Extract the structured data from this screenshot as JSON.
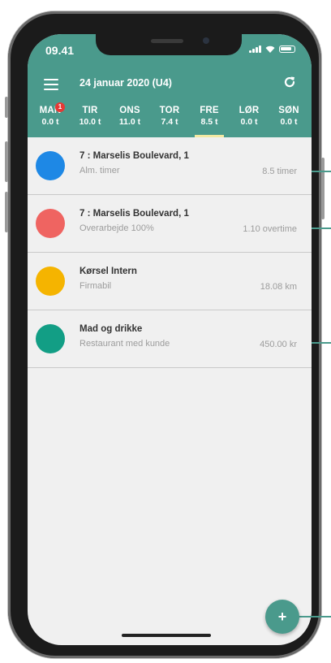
{
  "status_bar": {
    "time": "09.41"
  },
  "header": {
    "date_title": "24 januar 2020 (U4)"
  },
  "days": [
    {
      "name": "MAN",
      "hours": "0.0 t",
      "badge": "1",
      "active": false
    },
    {
      "name": "TIR",
      "hours": "10.0 t",
      "badge": "",
      "active": false
    },
    {
      "name": "ONS",
      "hours": "11.0 t",
      "badge": "",
      "active": false
    },
    {
      "name": "TOR",
      "hours": "7.4 t",
      "badge": "",
      "active": false
    },
    {
      "name": "FRE",
      "hours": "8.5 t",
      "badge": "",
      "active": true
    },
    {
      "name": "LØR",
      "hours": "0.0 t",
      "badge": "",
      "active": false
    },
    {
      "name": "SØN",
      "hours": "0.0 t",
      "badge": "",
      "active": false
    }
  ],
  "entries": [
    {
      "title": "7 : Marselis Boulevard, 1",
      "subtitle": "Alm. timer",
      "value": "8.5 timer",
      "color": "#1e88e5"
    },
    {
      "title": "7 : Marselis Boulevard, 1",
      "subtitle": "Overarbejde 100%",
      "value": "1.10 overtime",
      "color": "#ef6461"
    },
    {
      "title": "Kørsel Intern",
      "subtitle": "Firmabil",
      "value": "18.08 km",
      "color": "#f5b400"
    },
    {
      "title": "Mad og drikke",
      "subtitle": "Restaurant med kunde",
      "value": "450.00 kr",
      "color": "#129e85"
    }
  ],
  "fab": {
    "label": "+"
  },
  "colors": {
    "primary": "#4a9a8c",
    "active_underline": "#f3e9a3",
    "badge": "#e53935"
  },
  "icons": {
    "menu": "hamburger-icon",
    "refresh": "refresh-icon"
  }
}
